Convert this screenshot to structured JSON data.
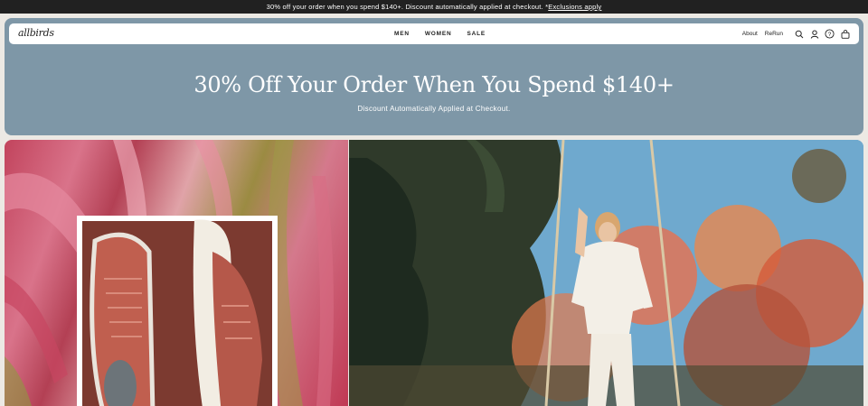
{
  "announcement": {
    "text": "30% off your order when you spend $140+. Discount automatically applied at checkout. *",
    "link": "Exclusions apply"
  },
  "header": {
    "logo": "allbirds",
    "nav": [
      "MEN",
      "WOMEN",
      "SALE"
    ],
    "links": [
      "About",
      "ReRun"
    ],
    "icons": [
      "search-icon",
      "account-icon",
      "help-icon",
      "cart-icon"
    ]
  },
  "hero": {
    "title": "30% Off Your Order When You Spend $140+",
    "subtitle": "Discount Automatically Applied at Checkout.",
    "bg_color": "#7e97a7"
  },
  "panels": {
    "left": "shoe-product-photo",
    "right": "woman-on-swing-photo"
  },
  "colors": {
    "topbar": "#212121",
    "hero": "#7e97a7",
    "shoe": "#b5584a"
  }
}
